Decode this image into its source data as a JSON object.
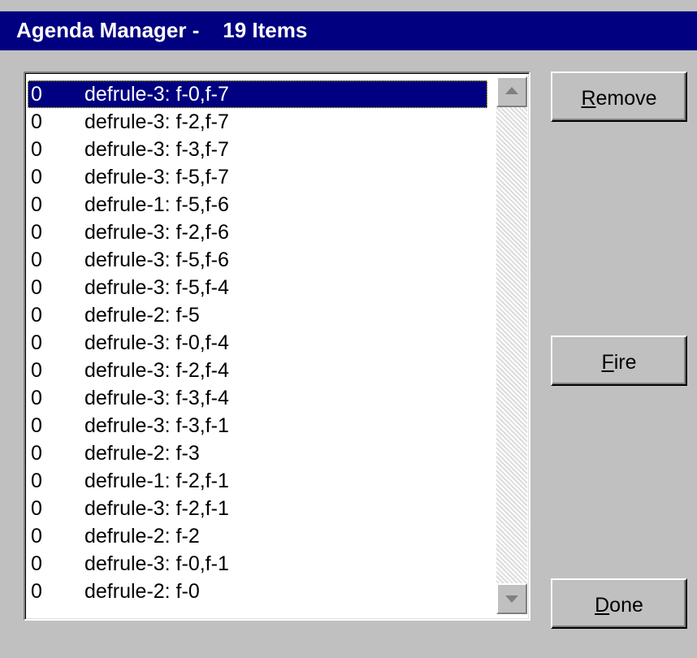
{
  "window": {
    "title": "Agenda Manager -    19 Items"
  },
  "agenda": {
    "selected_index": 0,
    "items": [
      {
        "priority": "0",
        "activation": "defrule-3: f-0,f-7"
      },
      {
        "priority": "0",
        "activation": "defrule-3: f-2,f-7"
      },
      {
        "priority": "0",
        "activation": "defrule-3: f-3,f-7"
      },
      {
        "priority": "0",
        "activation": "defrule-3: f-5,f-7"
      },
      {
        "priority": "0",
        "activation": "defrule-1: f-5,f-6"
      },
      {
        "priority": "0",
        "activation": "defrule-3: f-2,f-6"
      },
      {
        "priority": "0",
        "activation": "defrule-3: f-5,f-6"
      },
      {
        "priority": "0",
        "activation": "defrule-3: f-5,f-4"
      },
      {
        "priority": "0",
        "activation": "defrule-2: f-5"
      },
      {
        "priority": "0",
        "activation": "defrule-3: f-0,f-4"
      },
      {
        "priority": "0",
        "activation": "defrule-3: f-2,f-4"
      },
      {
        "priority": "0",
        "activation": "defrule-3: f-3,f-4"
      },
      {
        "priority": "0",
        "activation": "defrule-3: f-3,f-1"
      },
      {
        "priority": "0",
        "activation": "defrule-2: f-3"
      },
      {
        "priority": "0",
        "activation": "defrule-1: f-2,f-1"
      },
      {
        "priority": "0",
        "activation": "defrule-3: f-2,f-1"
      },
      {
        "priority": "0",
        "activation": "defrule-2: f-2"
      },
      {
        "priority": "0",
        "activation": "defrule-3: f-0,f-1"
      },
      {
        "priority": "0",
        "activation": "defrule-2: f-0"
      }
    ]
  },
  "buttons": {
    "remove": {
      "accel": "R",
      "rest": "emove"
    },
    "fire": {
      "accel": "F",
      "rest": "ire"
    },
    "done": {
      "accel": "D",
      "rest": "one"
    }
  },
  "icons": {
    "scroll_up": "scroll-up-arrow-icon",
    "scroll_down": "scroll-down-arrow-icon"
  },
  "colors": {
    "titlebar": "#000080",
    "selection": "#000080",
    "face": "#c0c0c0"
  }
}
